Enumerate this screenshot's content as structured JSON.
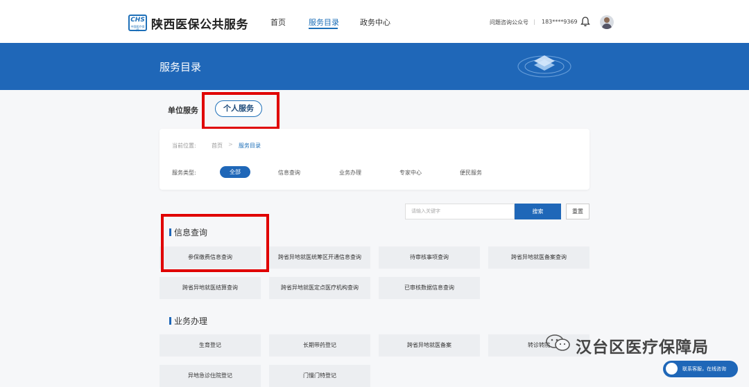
{
  "header": {
    "logo_text": "CHS",
    "logo_sub": "中国医疗保障",
    "brand": "陕西医保公共服务",
    "nav": [
      "首页",
      "服务目录",
      "政务中心"
    ],
    "active_nav": "服务目录",
    "consult_label": "问题咨询公众号",
    "separator": "|",
    "phone": "183****9369",
    "icons": [
      "bell-icon",
      "avatar"
    ]
  },
  "banner": {
    "title": "服务目录"
  },
  "service_tabs": {
    "unit": "单位服务",
    "personal": "个人服务"
  },
  "breadcrumb": {
    "label": "当前位置:",
    "home": "首页",
    "sep": ">",
    "current": "服务目录"
  },
  "filter": {
    "label": "服务类型:",
    "options": [
      "全部",
      "信息查询",
      "业务办理",
      "专家中心",
      "便民服务"
    ],
    "selected": "全部"
  },
  "search": {
    "placeholder": "请输入关键字",
    "button": "搜索",
    "reset": "重置"
  },
  "sections": [
    {
      "title": "信息查询",
      "items": [
        "参保缴费信息查询",
        "跨省异地就医统筹区开通信息查询",
        "待审核事项查询",
        "跨省异地就医备案查询",
        "跨省异地就医结算查询",
        "跨省异地就医定点医疗机构查询",
        "已审核数据信息查询"
      ]
    },
    {
      "title": "业务办理",
      "items": [
        "生育登记",
        "长期带药登记",
        "跨省异地就医备案",
        "转诊转院",
        "异地急诊住院登记",
        "门慢门特登记"
      ]
    }
  ],
  "watermark": {
    "text": "汉台区医疗保障局"
  },
  "chat_float": {
    "label": "联系客服，在线咨询"
  },
  "colors": {
    "primary": "#1f67b8",
    "highlight": "#e00000"
  }
}
